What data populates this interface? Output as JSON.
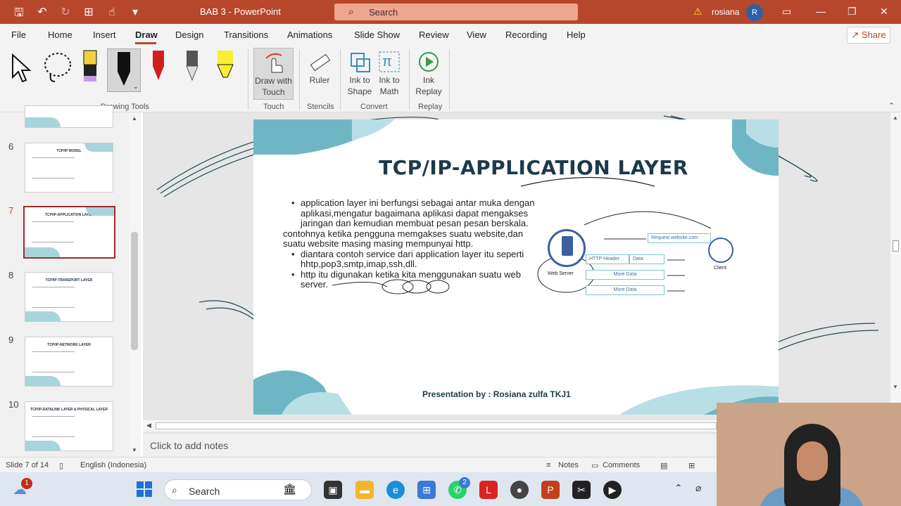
{
  "titlebar": {
    "title": "BAB 3  -  PowerPoint",
    "search": "Search",
    "user": "rosiana",
    "avatar_initial": "R"
  },
  "menu": [
    "File",
    "Home",
    "Insert",
    "Draw",
    "Design",
    "Transitions",
    "Animations",
    "Slide Show",
    "Review",
    "View",
    "Recording",
    "Help"
  ],
  "active_menu": "Draw",
  "share": "Share",
  "ribbon": {
    "draw_with_touch": "Draw with Touch",
    "ruler": "Ruler",
    "ink_to_shape": "Ink to Shape",
    "ink_to_math": "Ink to Math",
    "ink_replay": "Ink Replay",
    "groups": {
      "drawing_tools": "Drawing Tools",
      "touch": "Touch",
      "stencils": "Stencils",
      "convert": "Convert",
      "replay": "Replay"
    }
  },
  "thumbnails": [
    {
      "num": "6",
      "title": "TCP/IP MODEL"
    },
    {
      "num": "7",
      "title": "TCP/IP-APPLICATION LAYER"
    },
    {
      "num": "8",
      "title": "TCP/IP-TRANSPORT LAYER"
    },
    {
      "num": "9",
      "title": "TCP/IP-NETWORK LAYER"
    },
    {
      "num": "10",
      "title": "TCP/IP-DATALINK LAYER & PHYSICAL LAYER"
    }
  ],
  "slide": {
    "title": "TCP/IP-APPLICATION LAYER",
    "bullet1": "application layer ini berfungsi sebagai antar muka dengan aplikasi,mengatur bagaimana aplikasi dapat mengakses jaringan dan kemudian membuat pesan pesan berskala.",
    "plain1": "contohnya ketika pengguna memgakses suatu website,dan suatu website masing masing mempunyai http.",
    "bullet2": "diantara contoh service dari application layer itu seperti hhtp,pop3,smtp,imap,ssh,dll.",
    "bullet3": "http itu digunakan ketika kita menggunakan suatu web server.",
    "footer": "Presentation by : Rosiana zulfa TKJ1",
    "diagram": {
      "request": "Request website.com",
      "http_header": "HTTP Header",
      "data": "Data",
      "more_data_1": "More Data",
      "more_data_2": "More Data",
      "web_server": "Web Server",
      "client": "Client"
    }
  },
  "notes_placeholder": "Click to add notes",
  "status": {
    "slide": "Slide 7 of 14",
    "language": "English (Indonesia)",
    "notes": "Notes",
    "comments": "Comments"
  },
  "taskbar": {
    "search": "Search",
    "weather_badge": "1",
    "whatsapp_badge": "2"
  }
}
